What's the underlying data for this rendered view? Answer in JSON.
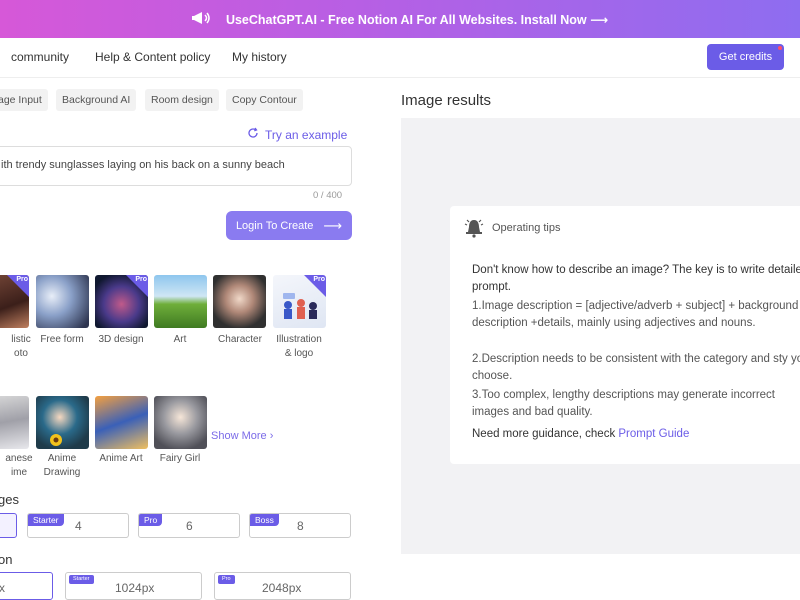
{
  "banner": {
    "icon": "megaphone-icon",
    "text": "UseChatGPT.AI - Free Notion AI For All Websites. Install Now ⟶"
  },
  "nav": {
    "links": [
      "community",
      "Help & Content policy",
      "My history"
    ],
    "credits_label": "Get credits"
  },
  "chips": [
    "age Input",
    "Background AI",
    "Room design",
    "Copy Contour"
  ],
  "prompt": {
    "try_example": "Try an example",
    "value": "ith trendy sunglasses laying on his back on a sunny beach",
    "counter": "0 / 400",
    "login_label": "Login To Create",
    "login_arrow": "⟶"
  },
  "styles_row1": [
    {
      "label": "listic",
      "label2": "oto",
      "pro": true
    },
    {
      "label": "Free form",
      "label2": "",
      "pro": false
    },
    {
      "label": "3D design",
      "label2": "",
      "pro": true
    },
    {
      "label": "Art",
      "label2": "",
      "pro": false
    },
    {
      "label": "Character",
      "label2": "",
      "pro": false
    },
    {
      "label": "Illustration",
      "label2": "& logo",
      "pro": true
    }
  ],
  "styles_row2": [
    {
      "label": "anese",
      "label2": "ime"
    },
    {
      "label": "Anime",
      "label2": "Drawing"
    },
    {
      "label": "Anime Art",
      "label2": ""
    },
    {
      "label": "Fairy Girl",
      "label2": ""
    }
  ],
  "pro_tag": "Pro",
  "show_more": "Show More ›",
  "images_label": "ges",
  "image_counts": [
    {
      "tag": "",
      "value": ""
    },
    {
      "tag": "Starter",
      "value": "4"
    },
    {
      "tag": "Pro",
      "value": "6"
    },
    {
      "tag": "Boss",
      "value": "8"
    }
  ],
  "resolution_label": "on",
  "resolutions": [
    {
      "tag": "",
      "value": "x"
    },
    {
      "tag": "Starter",
      "value": "1024px"
    },
    {
      "tag": "Pro",
      "value": "2048px"
    }
  ],
  "results": {
    "title": "Image results",
    "tips_title": "Operating tips",
    "question": "Don't know how to describe an image? The key is to write detailed prompt.",
    "tip1": "1.Image description = [adjective/adverb + subject] + background description +details, mainly using adjectives and nouns.",
    "tip2": "2.Description needs to be consistent with the category and sty you choose.",
    "tip3": "3.Too complex, lengthy descriptions may generate incorrect images and bad quality.",
    "guide_prefix": "Need more guidance, check ",
    "guide_link": "Prompt Guide"
  },
  "colors": {
    "accent": "#6b5ce7",
    "banner_start": "#d658d8",
    "banner_end": "#8e6df0"
  }
}
